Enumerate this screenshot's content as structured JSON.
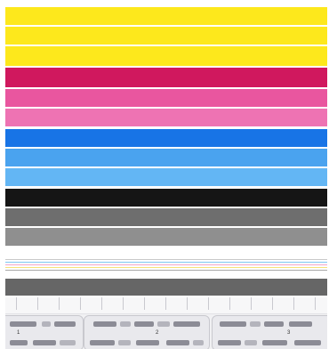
{
  "swatch_colors": {
    "yellow": "#fde81c",
    "magenta_dark": "#d0185e",
    "magenta_light": "#ee73b3",
    "cyan_dark": "#1874e6",
    "cyan_light": "#63b6f4",
    "black": "#151515",
    "gray_dark": "#6e6e6e",
    "gray_light": "#8f8f8f"
  },
  "ruler": {
    "labels": [
      "1",
      "2",
      "3"
    ]
  }
}
